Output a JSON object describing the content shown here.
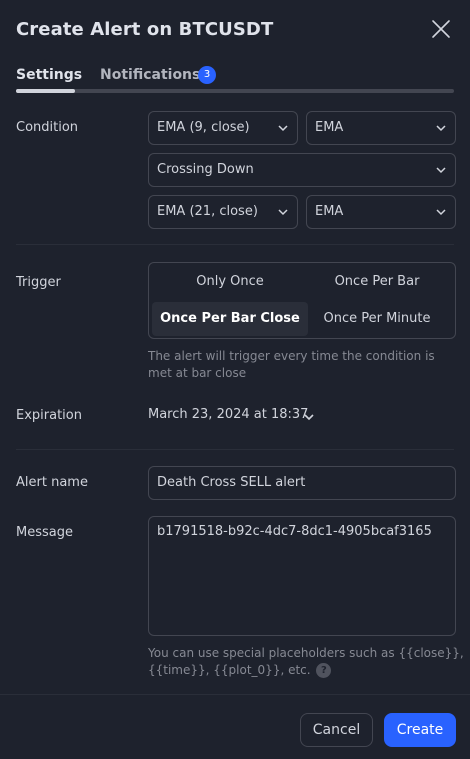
{
  "dialog": {
    "title": "Create Alert on BTCUSDT",
    "close_icon": "close-icon"
  },
  "tabs": {
    "settings": "Settings",
    "notifications": "Notifications",
    "notifications_badge": "3"
  },
  "condition": {
    "label": "Condition",
    "indicator_1": "EMA (9, close)",
    "plot_1": "EMA",
    "operator": "Crossing Down",
    "indicator_2": "EMA (21, close)",
    "plot_2": "EMA"
  },
  "trigger": {
    "label": "Trigger",
    "options": [
      "Only Once",
      "Once Per Bar",
      "Once Per Bar Close",
      "Once Per Minute"
    ],
    "selected": "Once Per Bar Close",
    "hint_line1": "The alert will trigger every time the condition is",
    "hint_line2": "met at bar close"
  },
  "expiration": {
    "label": "Expiration",
    "value": "March 23, 2024 at 18:37"
  },
  "alert_name": {
    "label": "Alert name",
    "value": "Death Cross SELL alert"
  },
  "message": {
    "label": "Message",
    "value": "b1791518-b92c-4dc7-8dc1-4905bcaf3165",
    "hint_line1": "You can use special placeholders such as {{close}},",
    "hint_line2": "{{time}}, {{plot_0}}, etc."
  },
  "footer": {
    "cancel": "Cancel",
    "create": "Create"
  },
  "colors": {
    "background": "#1e222d",
    "accent": "#2962ff",
    "border": "#434651",
    "text": "#d1d4dc",
    "muted": "#868993"
  }
}
